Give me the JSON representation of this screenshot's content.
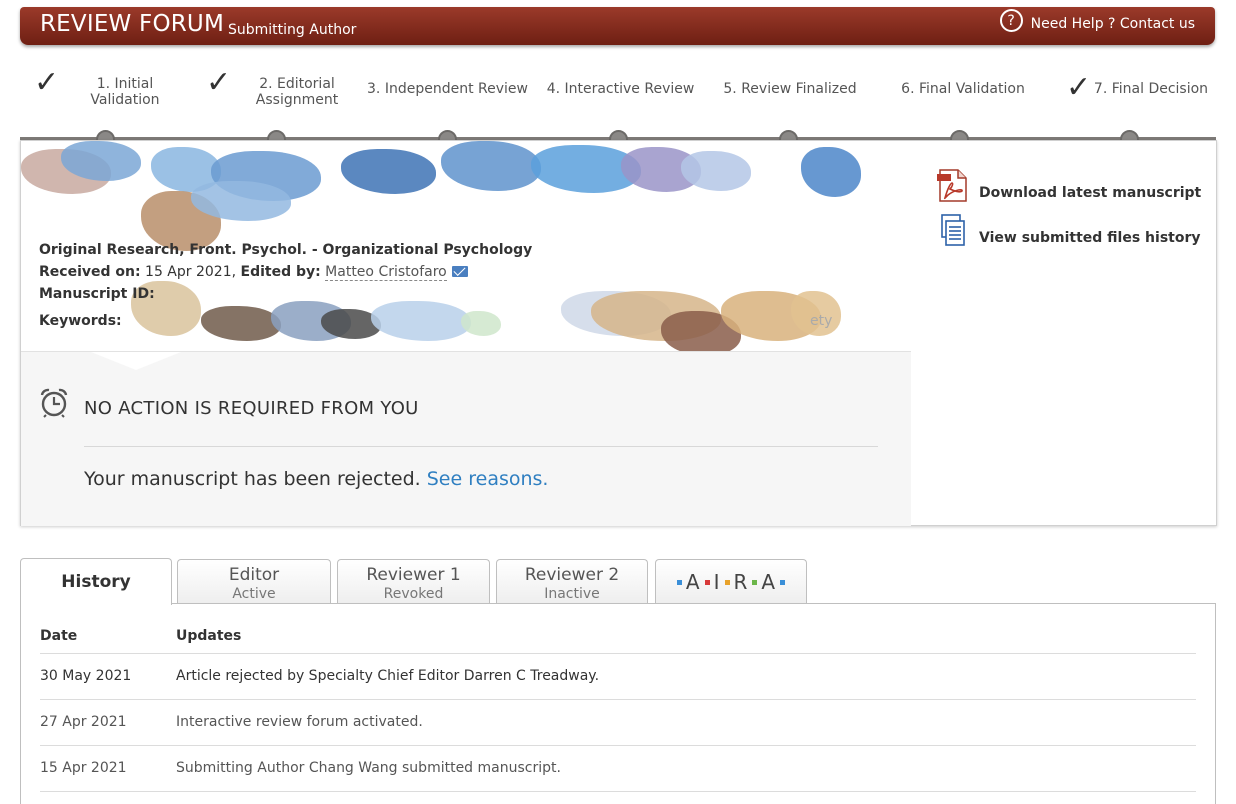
{
  "header": {
    "title": "REVIEW FORUM",
    "subtitle": "Submitting Author",
    "help_icon": "?",
    "help_label": "Need Help ? Contact us"
  },
  "steps": [
    {
      "label_line1": "1. Initial",
      "label_line2": "Validation",
      "completed": true
    },
    {
      "label_line1": "2. Editorial",
      "label_line2": "Assignment",
      "completed": true
    },
    {
      "label_line1": "3. Independent Review",
      "label_line2": "",
      "completed": false
    },
    {
      "label_line1": "4. Interactive Review",
      "label_line2": "",
      "completed": false
    },
    {
      "label_line1": "5. Review Finalized",
      "label_line2": "",
      "completed": false
    },
    {
      "label_line1": "6. Final Validation",
      "label_line2": "",
      "completed": false
    },
    {
      "label_line1": "7. Final Decision",
      "label_line2": "",
      "completed": true
    }
  ],
  "manuscript": {
    "type_line": "Original Research, Front. Psychol. - Organizational Psychology",
    "received_label": "Received on:",
    "received_date": "15 Apr 2021,",
    "edited_label": "Edited by:",
    "editor_name": "Matteo Cristofaro",
    "manuscript_id_label": "Manuscript ID:",
    "keywords_label": "Keywords:",
    "keywords_tail": "ety"
  },
  "side_links": {
    "download": "Download latest manuscript",
    "history": "View submitted files history"
  },
  "action": {
    "title": "NO ACTION IS REQUIRED FROM YOU",
    "message": "Your manuscript has been rejected.",
    "link": "See reasons."
  },
  "tabs": [
    {
      "label": "History",
      "sub": ""
    },
    {
      "label": "Editor",
      "sub": "Active"
    },
    {
      "label": "Reviewer 1",
      "sub": "Revoked"
    },
    {
      "label": "Reviewer 2",
      "sub": "Inactive"
    },
    {
      "label": "A I R A",
      "sub": ""
    }
  ],
  "aira": {
    "letters": [
      "A",
      "I",
      "R",
      "A"
    ],
    "colors": [
      "#3a8fd8",
      "#d83a3a",
      "#e8a22a",
      "#6cb64a",
      "#3a8fd8"
    ]
  },
  "history_table": {
    "col_date": "Date",
    "col_updates": "Updates",
    "rows": [
      {
        "date": "30 May 2021",
        "text": "Article rejected by Specialty Chief Editor Darren C Treadway."
      },
      {
        "date": "27 Apr 2021",
        "text": "Interactive review forum activated."
      },
      {
        "date": "15 Apr 2021",
        "text": "Submitting Author Chang Wang submitted manuscript."
      }
    ]
  }
}
